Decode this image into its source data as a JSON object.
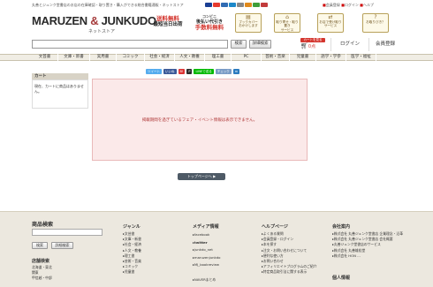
{
  "header": {
    "note": "丸善とジュンク堂書店のお店の在庫確認・取り置き・購入ができる総合書籍通販・ネットストア",
    "links": [
      "会員登録",
      "ログイン",
      "ヘルプ",
      "サイトマップ"
    ],
    "logo_main": "MARUZEN",
    "logo_amp": "&",
    "logo_second": "JUNKUDO",
    "logo_sub": "ネットストア",
    "promo_shipping_line1": "送料無料",
    "promo_shipping_line2": "最短当日出荷",
    "promo_cod_line1": "コンビニ",
    "promo_cod_line2": "後払い代引き",
    "promo_cod_line3": "手数料無料",
    "icon_buttons": [
      {
        "label": "ブックカバー\nおかけします",
        "icon": "book-icon"
      },
      {
        "label": "取り寄せ・取り置き\nサービス",
        "icon": "store-icon"
      },
      {
        "label": "お店で受け取り\nサービス",
        "icon": "pickup-icon"
      },
      {
        "label": "お取りびき？",
        "icon": "question-icon"
      }
    ]
  },
  "search": {
    "placeholder": "",
    "search_label": "検索",
    "detail_label": "詳細検索",
    "cart_label": "カートを見る",
    "cart_count": "0点",
    "login_label": "ログイン",
    "register_label": "会員登録"
  },
  "nav": {
    "items": [
      "文芸書",
      "文庫・新書",
      "実用書",
      "コミック",
      "社会・経済",
      "人文・教養",
      "理工書",
      "PC",
      "芸術・音楽",
      "児童書",
      "語学・学参",
      "医学・福祉"
    ]
  },
  "sidebar": {
    "cart_title": "カート",
    "cart_message": "現在、カートに商品はありません。"
  },
  "social": {
    "tweet": "ツイート",
    "like": "いいね",
    "line": "LINEで送る",
    "check": "チェック"
  },
  "main": {
    "message": "掲載期間を過ぎているフェア・イベント情報は表示できません。",
    "top_button": "トップページへ"
  },
  "footer": {
    "search_title": "商品検索",
    "search_button": "検索",
    "detail_button": "詳細検索",
    "store_title": "店舗検索",
    "stores": [
      "北海道・東北",
      "関東",
      "甲信越・中部"
    ],
    "genre_title": "ジャンル",
    "genres": [
      "文芸書",
      "文庫・新書",
      "社会・経済",
      "人文・教養",
      "理工書",
      "芸術・音楽",
      "コミック",
      "児童書"
    ],
    "media_title": "メディア情報",
    "media": [
      "facebook",
      "twitter",
      "junkdo_net",
      "maruzenjunkdo",
      "MJ_bookreview",
      "",
      "NAVERまとめ"
    ],
    "help_title": "ヘルプページ",
    "help": [
      "よくある質問",
      "会員登録・ログイン",
      "本を探す",
      "注文・お問い合わせについて",
      "便利な使い方",
      "お問い合わせ",
      "アフィリエイトプログラムのご紹介",
      "特定商品取引法に関する表示"
    ],
    "company_title": "会社案内",
    "company": [
      "株式会社 丸善ジュンク堂書店 企業理念・沿革",
      "株式会社 丸善ジュンク堂書店 会社概要",
      "丸善ジュンク堂書店のサービス",
      "株式会社 丸善雄松堂",
      "株式会社 HON ..."
    ],
    "privacy_title": "個人情報"
  },
  "colors": {
    "accent_red": "#d4352e",
    "nav_bg": "#f0ede4",
    "panel_bg": "#fbe9e9",
    "message": "#b03a3a",
    "top_button": "#4e5a66"
  }
}
